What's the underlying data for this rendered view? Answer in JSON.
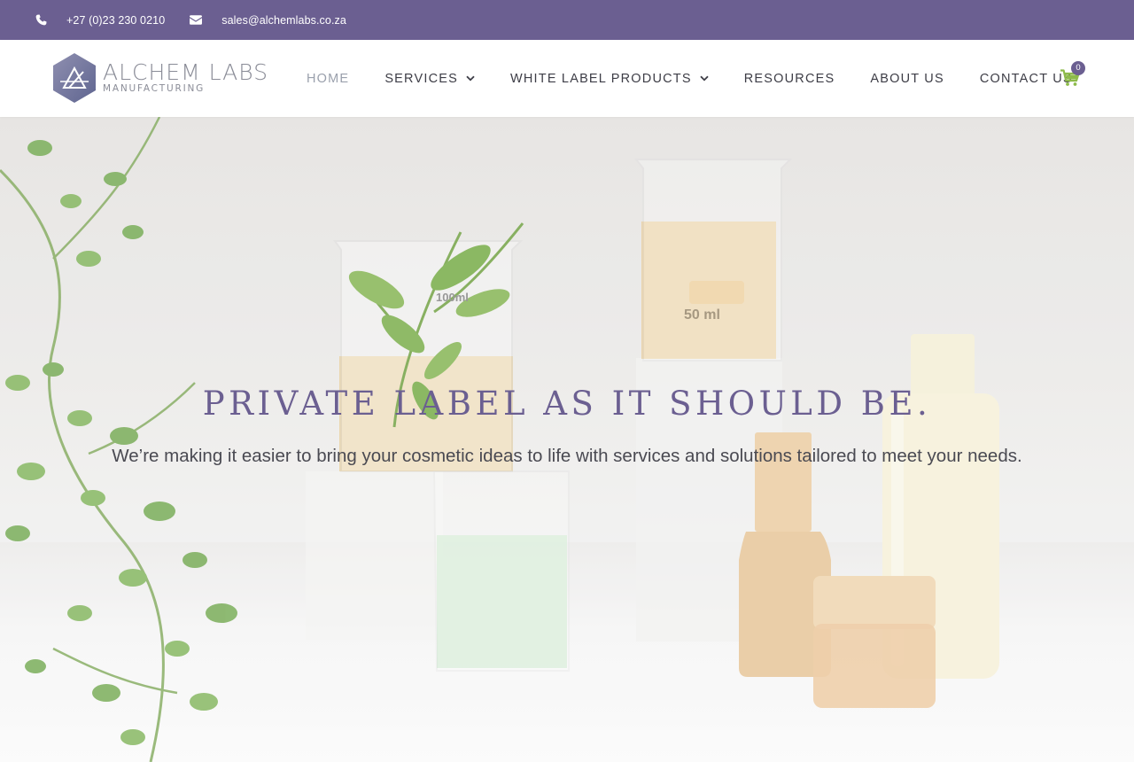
{
  "topbar": {
    "phone": "+27 (0)23 230 0210",
    "email": "sales@alchemlabs.co.za",
    "phone_icon": "phone-icon",
    "email_icon": "envelope-icon"
  },
  "logo": {
    "brand": "ALCHEM LABS",
    "tagline": "MANUFACTURING"
  },
  "nav": {
    "items": [
      {
        "label": "HOME",
        "active": true,
        "dropdown": false
      },
      {
        "label": "SERVICES",
        "active": false,
        "dropdown": true
      },
      {
        "label": "WHITE LABEL PRODUCTS",
        "active": false,
        "dropdown": true
      },
      {
        "label": "RESOURCES",
        "active": false,
        "dropdown": false
      },
      {
        "label": "ABOUT US",
        "active": false,
        "dropdown": false
      },
      {
        "label": "CONTACT US",
        "active": false,
        "dropdown": false
      }
    ]
  },
  "cart": {
    "count": "0",
    "icon": "cart-icon"
  },
  "hero": {
    "title": "PRIVATE LABEL AS IT SHOULD BE.",
    "subtitle": "We’re making it easier to bring your cosmetic ideas to life with services and solutions tailored to meet your needs.",
    "beaker_large_label": "100ml",
    "beaker_small_label": "50 ml"
  },
  "colors": {
    "brand_purple": "#6b5f91",
    "cart_green": "#8dbb4a",
    "nav_text": "#3d3d46",
    "nav_active": "#9aa0ac"
  }
}
